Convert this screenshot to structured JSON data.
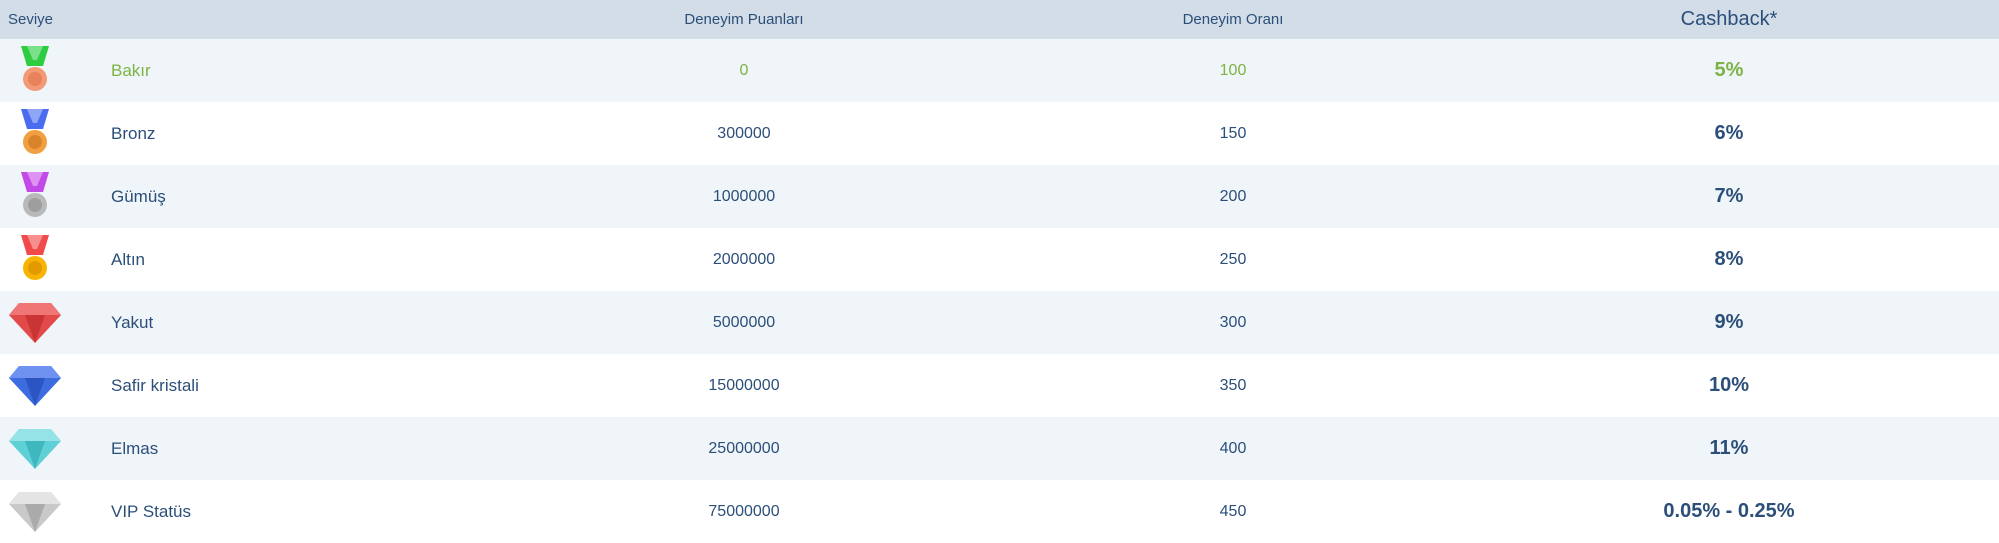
{
  "header": {
    "level": "Seviye",
    "points": "Deneyim Puanları",
    "rate": "Deneyim Oranı",
    "cashback": "Cashback*"
  },
  "rows": [
    {
      "name": "Bakır",
      "points": "0",
      "rate": "100",
      "cashback": "5%",
      "icon": "copper-medal-icon",
      "ribbon": "#2ecc40",
      "medal": "#f29a76"
    },
    {
      "name": "Bronz",
      "points": "300000",
      "rate": "150",
      "cashback": "6%",
      "icon": "bronze-medal-icon",
      "ribbon": "#4a6cf0",
      "medal": "#f0a040"
    },
    {
      "name": "Gümüş",
      "points": "1000000",
      "rate": "200",
      "cashback": "7%",
      "icon": "silver-medal-icon",
      "ribbon": "#c24be8",
      "medal": "#b9b9b9"
    },
    {
      "name": "Altın",
      "points": "2000000",
      "rate": "250",
      "cashback": "8%",
      "icon": "gold-medal-icon",
      "ribbon": "#f04a4a",
      "medal": "#f7b500"
    },
    {
      "name": "Yakut",
      "points": "5000000",
      "rate": "300",
      "cashback": "9%",
      "icon": "ruby-gem-icon",
      "gem": "#e24a4a"
    },
    {
      "name": "Safir kristali",
      "points": "15000000",
      "rate": "350",
      "cashback": "10%",
      "icon": "sapphire-gem-icon",
      "gem": "#3d6be0"
    },
    {
      "name": "Elmas",
      "points": "25000000",
      "rate": "400",
      "cashback": "11%",
      "icon": "diamond-gem-icon",
      "gem": "#5fd0d6"
    },
    {
      "name": "VIP Statüs",
      "points": "75000000",
      "rate": "450",
      "cashback": "0.05% - 0.25%",
      "icon": "vip-gem-icon",
      "gem": "#c9c9c9"
    }
  ],
  "colors": {
    "header_bg": "#d3dde8",
    "row_alt_bg": "#f0f5fa",
    "text": "#2b4f79",
    "active_text": "#7cb342"
  }
}
